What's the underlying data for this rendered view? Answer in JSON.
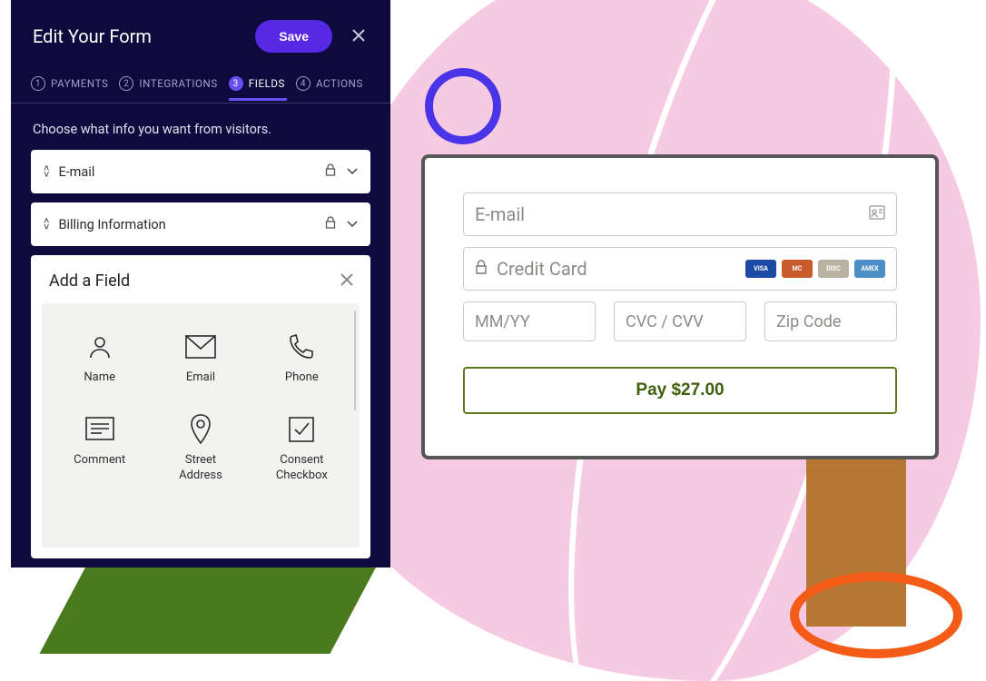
{
  "editor": {
    "title": "Edit Your Form",
    "save_label": "Save",
    "tabs": [
      {
        "num": "1",
        "label": "PAYMENTS"
      },
      {
        "num": "2",
        "label": "INTEGRATIONS"
      },
      {
        "num": "3",
        "label": "FIELDS"
      },
      {
        "num": "4",
        "label": "ACTIONS"
      }
    ],
    "active_tab_index": 2,
    "subhead": "Choose what info you want from visitors.",
    "fields": [
      {
        "label": "E-mail",
        "locked": true
      },
      {
        "label": "Billing Information",
        "locked": true
      }
    ],
    "add_panel": {
      "title": "Add a Field",
      "options": [
        {
          "icon": "user-icon",
          "label": "Name"
        },
        {
          "icon": "mail-icon",
          "label": "Email"
        },
        {
          "icon": "phone-icon",
          "label": "Phone"
        },
        {
          "icon": "comment-icon",
          "label": "Comment"
        },
        {
          "icon": "pin-icon",
          "label": "Street\nAddress"
        },
        {
          "icon": "checkbox-icon",
          "label": "Consent\nCheckbox"
        }
      ]
    }
  },
  "payment": {
    "email_placeholder": "E-mail",
    "cc_placeholder": "Credit Card",
    "exp_placeholder": "MM/YY",
    "cvc_placeholder": "CVC / CVV",
    "zip_placeholder": "Zip Code",
    "pay_label": "Pay $27.00",
    "card_brands": [
      "VISA",
      "MC",
      "DISC",
      "AMEX"
    ]
  }
}
